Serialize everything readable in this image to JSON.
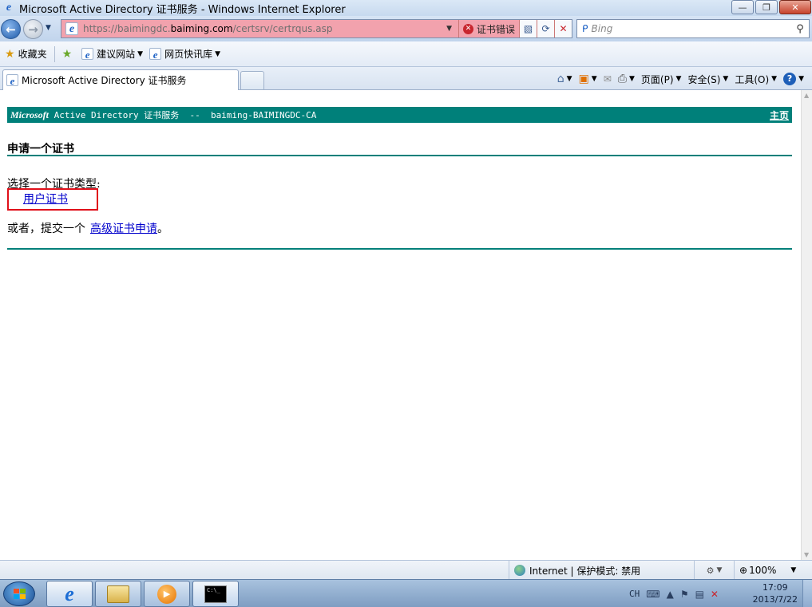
{
  "window": {
    "title": "Microsoft Active Directory 证书服务 - Windows Internet Explorer",
    "min_label": "—",
    "max_label": "❐",
    "close_label": "✕"
  },
  "address_bar": {
    "url_prefix": "https://baimingdc.",
    "url_domain": "baiming.com",
    "url_suffix": "/certsrv/certrqus.asp",
    "cert_error_label": "证书错误"
  },
  "search": {
    "placeholder": "Bing"
  },
  "favorites_bar": {
    "favorites_label": "收藏夹",
    "suggested_sites_label": "建议网站",
    "web_slice_label": "网页快讯库"
  },
  "tabs": [
    {
      "label": "Microsoft Active Directory 证书服务"
    }
  ],
  "command_bar": {
    "page_label": "页面(P)",
    "safety_label": "安全(S)",
    "tools_label": "工具(O)",
    "help_label": "?"
  },
  "page": {
    "banner_brand": "Microsoft",
    "banner_text": " Active Directory 证书服务  --  baiming-BAIMINGDC-CA",
    "home_link": "主页",
    "heading": "申请一个证书",
    "choose_label": "选择一个证书类型:",
    "user_cert_link": "用户证书",
    "or_text": "或者，提交一个",
    "advanced_link": "高级证书申请",
    "or_suffix": "。"
  },
  "status_bar": {
    "zone_text": "Internet | 保护模式: 禁用",
    "zoom_text": "100%"
  },
  "taskbar": {
    "lang": "CH",
    "time": "17:09",
    "date": "2013/7/22",
    "cmd_icon_text": "C:\\_"
  },
  "colors": {
    "banner": "#00807a",
    "address_bar_error": "#f2a2ad",
    "highlight_box": "#e0101a",
    "link": "#0000cc"
  }
}
